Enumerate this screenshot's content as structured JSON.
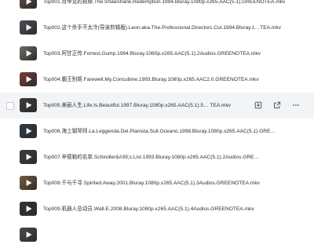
{
  "files": [
    {
      "name": "Top001.肖申克的救赎.The.Shawshank.Redemption.1994.Bluray.1080p.x265.AAC(5.1).GREENOTEA.mkv",
      "thumb": "#5a4b3f"
    },
    {
      "name": "Top002.这个杀手不太冷(导演剪辑版).Leon.aka.The.Professional.Directors.Cut.1994.Bluray.1…TEA.mkv",
      "thumb": "#4b4f55"
    },
    {
      "name": "Top003.阿甘正传.Forrest.Gump.1994.Bluray.1080p.x265.AAC(5.1).2Audios.GREENOTEA.mkv",
      "thumb": "#6a6f63"
    },
    {
      "name": "Top004.霸王别姬.Farewell.My.Concubine.1993.Bluray.1080p.x265.AAC2.0.GREENOTEA.mkv",
      "thumb": "#7a3b32"
    },
    {
      "name": "Top005.美丽人生.Life.Is.Beautiful.1997.Bluray.1080p.x265.AAC(5.1).5…  TEA.mkv",
      "thumb": "#3e3a35",
      "hover": true
    },
    {
      "name": "Top006.海上钢琴师.La.Leggenda.Del.Pianista.Sull.Oceano.1998.Bluray.1080p.x265.AAC(5.1).GRE…",
      "thumb": "#2f3a44"
    },
    {
      "name": "Top007.辛德勒的名单.Schindler&#39;s.List.1993.Bluray.1080p.x265.AAC(5.1).2Audios.GRE…",
      "thumb": "#3c3c3c"
    },
    {
      "name": "Top008.千与千寻.Spirited.Away.2001.Bluray.1080p.x265.AAC(5.1).3Audios.GREENOTEA.mkv",
      "thumb": "#7a5a3a"
    },
    {
      "name": "Top009.机器人总动员.Wall-E.2008.Bluray.1080p.x265.AAC(5.1).4Audios.GREENOTEA.mkv",
      "thumb": "#33302c"
    },
    {
      "name": "",
      "thumb": "#4a4a4a"
    }
  ],
  "row_actions": {
    "download_icon": "download-icon",
    "share_icon": "share-icon",
    "more_icon": "more-icon"
  }
}
